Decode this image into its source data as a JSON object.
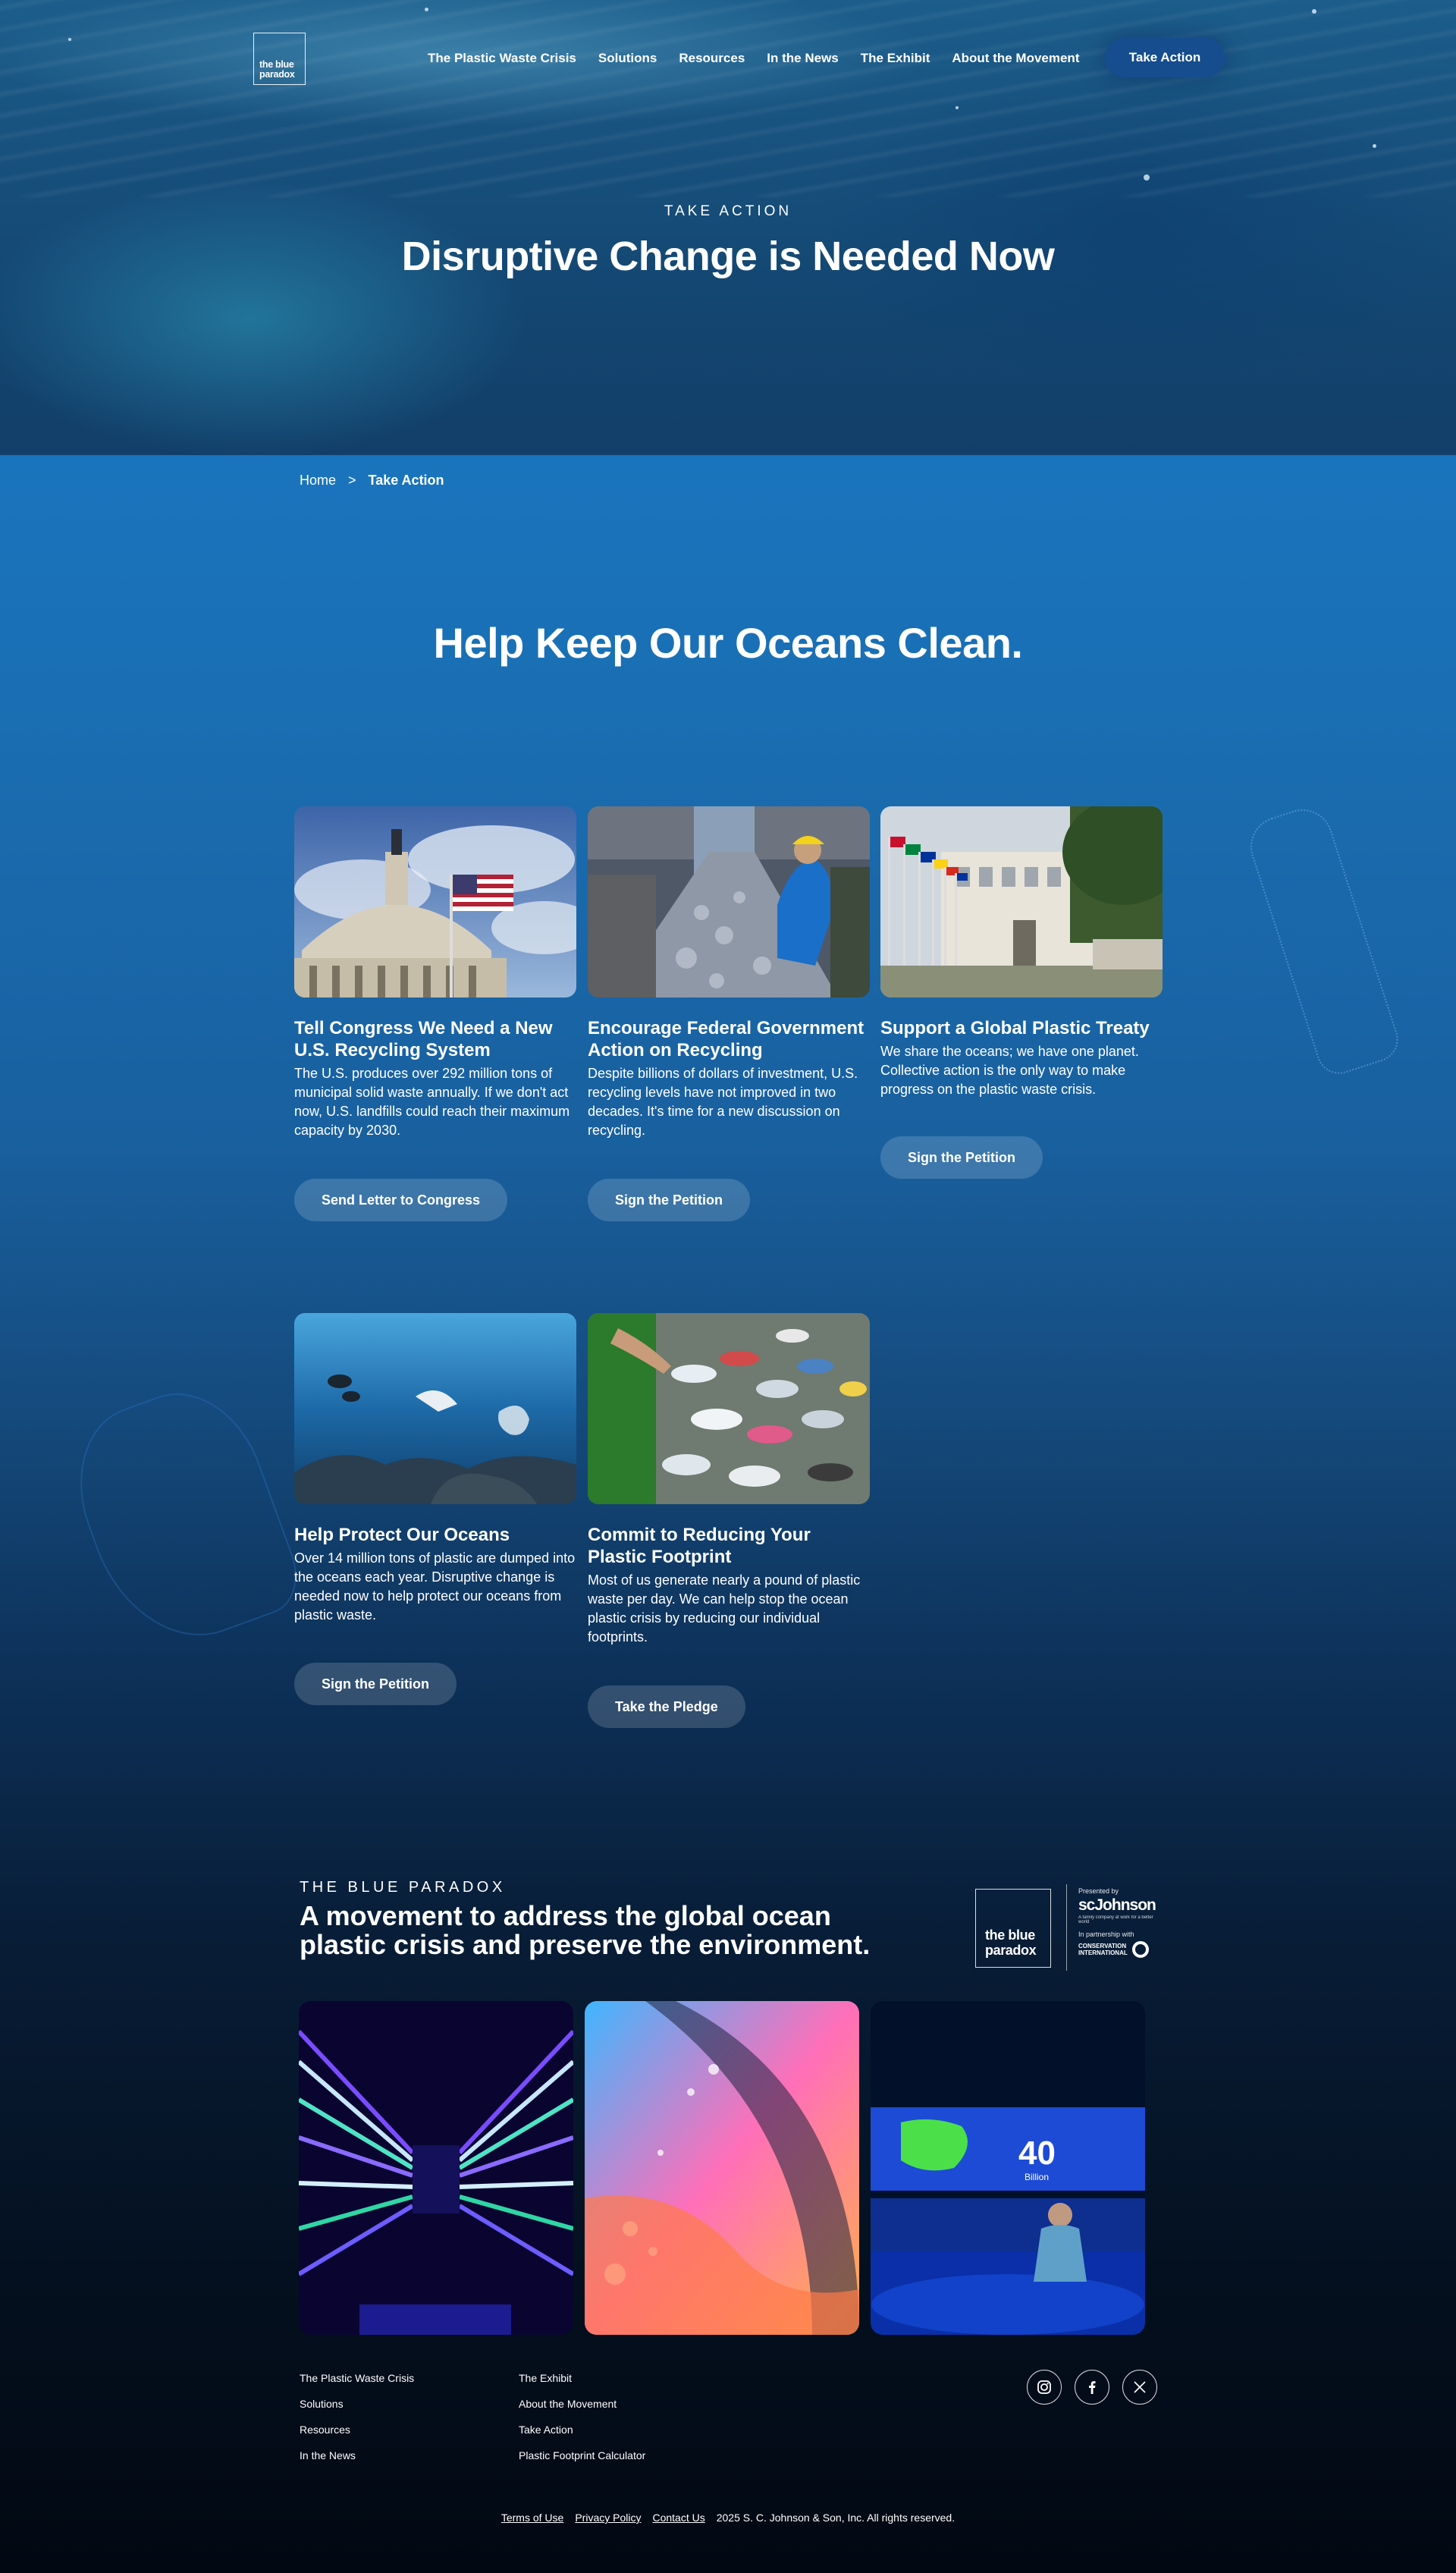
{
  "brand": {
    "logo_line1": "the blue",
    "logo_line2": "paradox"
  },
  "nav": {
    "items": [
      "The Plastic Waste Crisis",
      "Solutions",
      "Resources",
      "In the News",
      "The Exhibit",
      "About the Movement"
    ],
    "cta": "Take Action"
  },
  "hero": {
    "eyebrow": "TAKE ACTION",
    "title": "Disruptive Change is Needed Now"
  },
  "breadcrumb": {
    "home": "Home",
    "separator": ">",
    "current": "Take Action"
  },
  "section": {
    "title": "Help Keep Our Oceans Clean."
  },
  "cards": [
    {
      "title": "Tell Congress We Need a New U.S. Recycling System",
      "body": "The U.S. produces over 292 million tons of municipal solid waste annually. If we don't act now, U.S. landfills could reach their maximum capacity by 2030.",
      "button": "Send Letter to Congress",
      "image": "capitol-dome-with-flag"
    },
    {
      "title": "Encourage Federal Government Action on Recycling",
      "body": "Despite billions of dollars of investment, U.S. recycling levels have not improved in two decades. It's time for a new discussion on recycling.",
      "button": "Sign the Petition",
      "image": "recycling-sorting-line-worker"
    },
    {
      "title": "Support a Global Plastic Treaty",
      "body": "We share the oceans; we have one planet. Collective action is the only way to make progress on the plastic waste crisis.",
      "button": "Sign the Petition",
      "image": "un-flags-building"
    },
    {
      "title": "Help Protect Our Oceans",
      "body": "Over 14 million tons of plastic are dumped into the oceans each year. Disruptive change is needed now to help protect our oceans from plastic waste.",
      "button": "Sign the Petition",
      "image": "underwater-fish-plastic-bag"
    },
    {
      "title": "Commit to Reducing Your Plastic Footprint",
      "body": "Most of us generate nearly a pound of plastic waste per day. We can help stop the ocean plastic crisis by reducing our individual footprints.",
      "button": "Take the Pledge",
      "image": "plastic-bottles-pile"
    }
  ],
  "promo": {
    "eyebrow": "THE BLUE PARADOX",
    "title": "A movement to address the global ocean plastic crisis and preserve the environment.",
    "logo_line1": "the blue",
    "logo_line2": "paradox",
    "presented_by": "Presented by",
    "sponsor": "scJohnson",
    "sponsor_tag": "A family company at work for a better world",
    "partnership": "In partnership with",
    "partner_line1": "CONSERVATION",
    "partner_line2": "INTERNATIONAL",
    "photos": [
      "exhibit-light-tunnel",
      "exhibit-colorful-plastic-art",
      "exhibit-screen-visitor"
    ],
    "photo_screen_number": "40",
    "photo_screen_unit": "Billion"
  },
  "footer": {
    "col1": [
      "The Plastic Waste Crisis",
      "Solutions",
      "Resources",
      "In the News"
    ],
    "col2": [
      "The Exhibit",
      "About the Movement",
      "Take Action",
      "Plastic Footprint Calculator"
    ],
    "social": [
      "instagram-icon",
      "facebook-icon",
      "x-icon"
    ],
    "legal_links": [
      "Terms of Use",
      "Privacy Policy",
      "Contact Us"
    ],
    "copyright": "2025 S. C. Johnson & Son, Inc. All rights reserved."
  }
}
